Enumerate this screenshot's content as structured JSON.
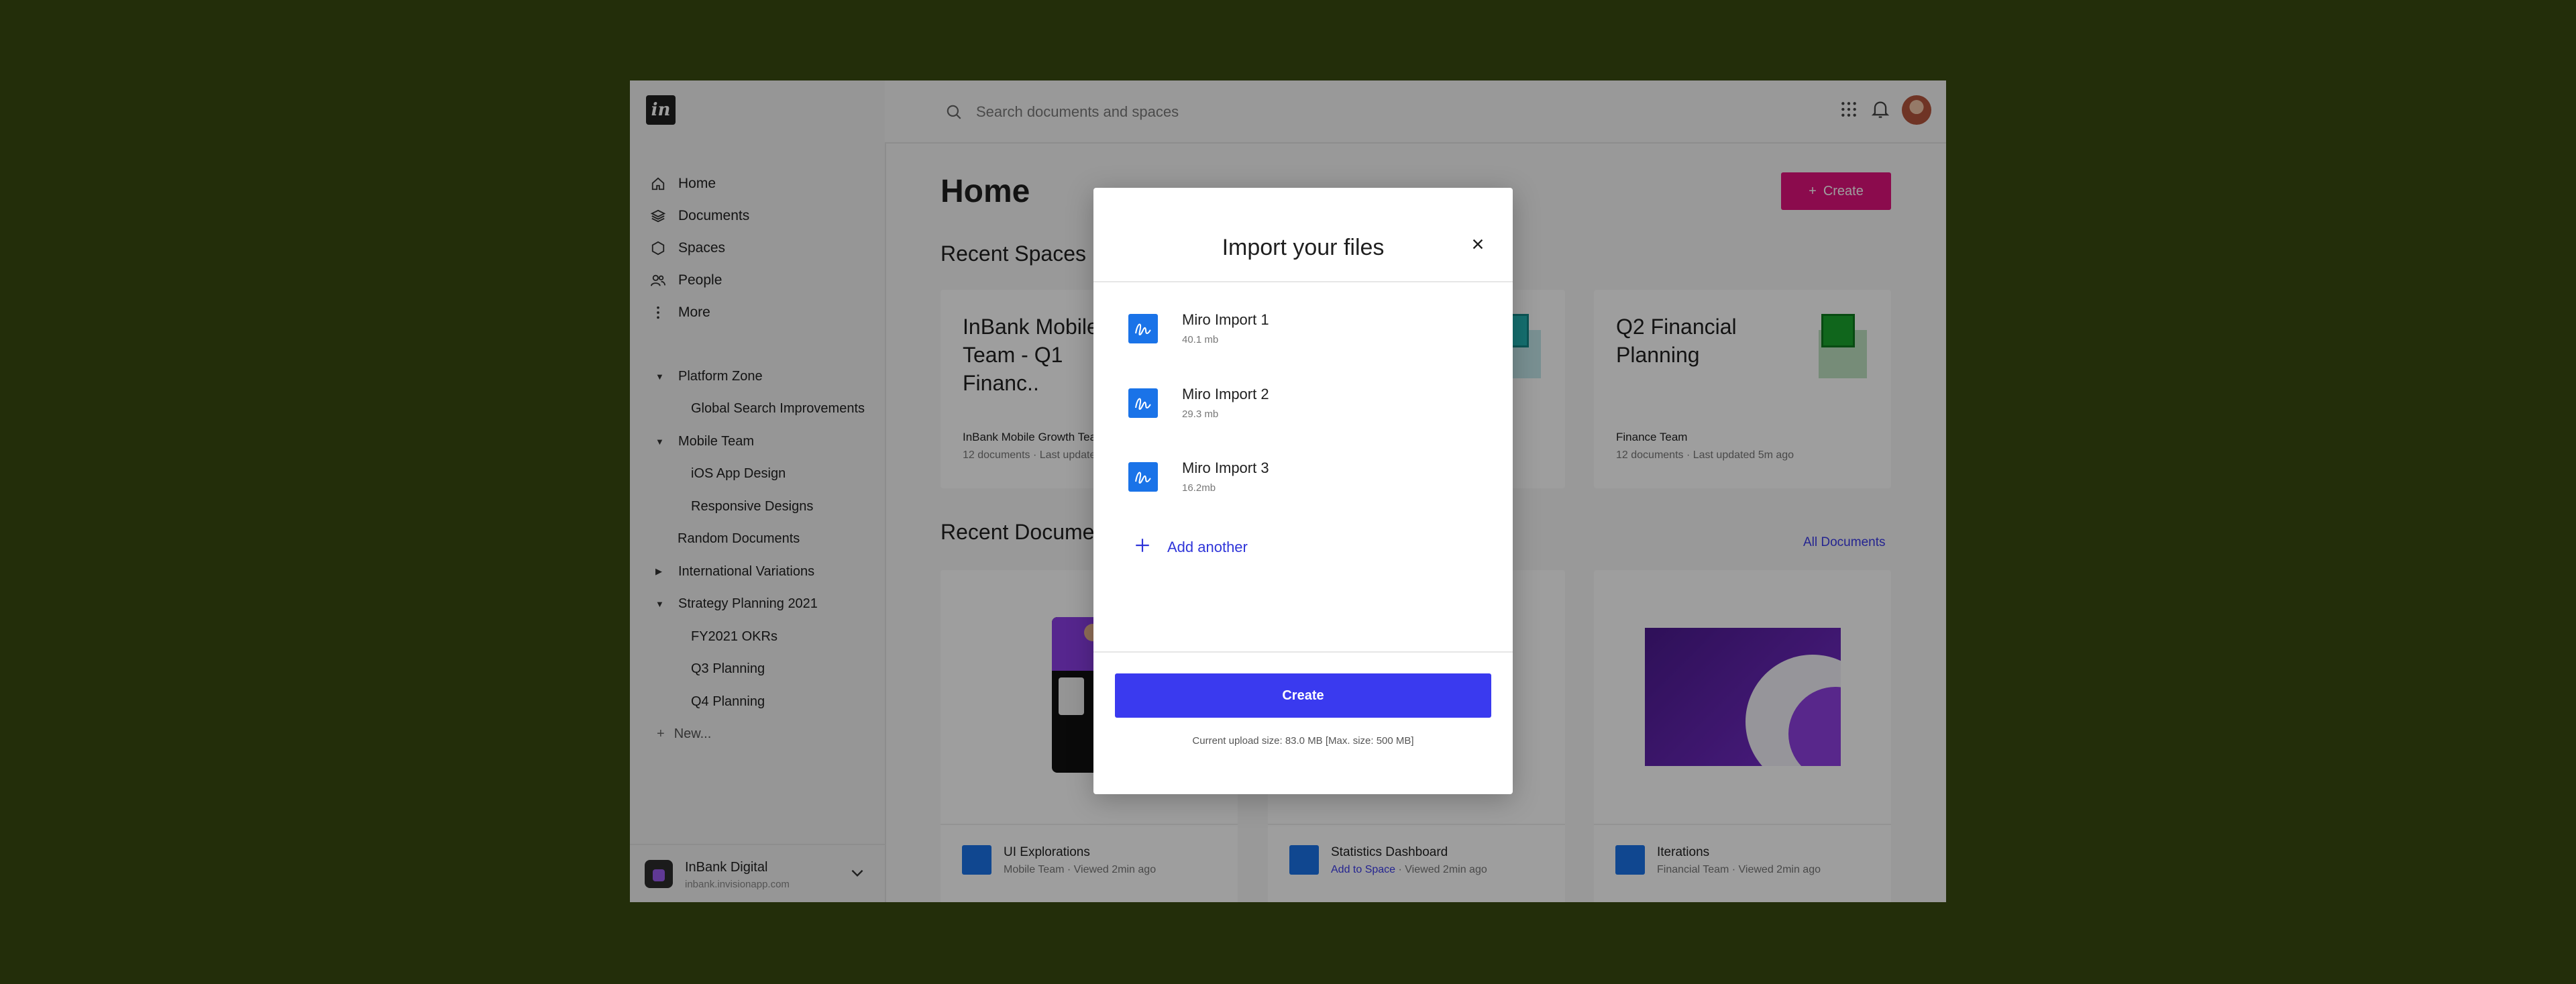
{
  "sidebar": {
    "nav": [
      {
        "label": "Home",
        "icon": "home-icon"
      },
      {
        "label": "Documents",
        "icon": "layers-icon"
      },
      {
        "label": "Spaces",
        "icon": "hexagon-icon"
      },
      {
        "label": "People",
        "icon": "people-icon"
      },
      {
        "label": "More",
        "icon": "more-vertical-icon"
      }
    ],
    "tree": [
      {
        "label": "Platform Zone",
        "level": 0,
        "expanded": true
      },
      {
        "label": "Global Search Improvements",
        "level": 1
      },
      {
        "label": "Mobile Team",
        "level": 0,
        "expanded": true
      },
      {
        "label": "iOS App Design",
        "level": 1
      },
      {
        "label": "Responsive Designs",
        "level": 1
      },
      {
        "label": "Random Documents",
        "level": 0
      },
      {
        "label": "International Variations",
        "level": 0,
        "expanded": false
      },
      {
        "label": "Strategy Planning 2021",
        "level": 0,
        "expanded": true
      },
      {
        "label": "FY2021 OKRs",
        "level": 1
      },
      {
        "label": "Q3 Planning",
        "level": 1
      },
      {
        "label": "Q4 Planning",
        "level": 1
      }
    ],
    "new_label": "New...",
    "workspace": {
      "name": "InBank Digital",
      "url": "inbank.invisionapp.com"
    }
  },
  "topbar": {
    "search_placeholder": "Search documents and spaces"
  },
  "main": {
    "title": "Home",
    "create_label": "Create",
    "recent_spaces_title": "Recent Spaces",
    "recent_documents_title": "Recent Documents",
    "all_documents_label": "All Documents",
    "spaces": [
      {
        "title": "InBank Mobile Team - Q1 Financ..",
        "team": "InBank Mobile Growth Team",
        "documents": "12 documents",
        "updated": "Last updated 5m ago"
      },
      {
        "title": "",
        "team": "",
        "documents": "",
        "updated": ""
      },
      {
        "title": "Q2 Financial Planning",
        "team": "Finance Team",
        "documents": "12 documents",
        "updated": "Last updated 5m ago"
      }
    ],
    "documents": [
      {
        "title": "UI Explorations",
        "team": "Mobile Team",
        "viewed": "Viewed 2min ago"
      },
      {
        "title": "Statistics Dashboard",
        "team": "Add to Space",
        "viewed": "Viewed 2min ago"
      },
      {
        "title": "Iterations",
        "team": "Financial Team",
        "viewed": "Viewed 2min ago"
      }
    ]
  },
  "modal": {
    "title": "Import your files",
    "files": [
      {
        "name": "Miro Import 1",
        "size": "40.1 mb"
      },
      {
        "name": "Miro Import 2",
        "size": "29.3 mb"
      },
      {
        "name": "Miro Import 3",
        "size": "16.2mb"
      }
    ],
    "add_another_label": "Add another",
    "create_label": "Create",
    "upload_note": "Current upload size: 83.0 MB [Max. size: 500 MB]"
  },
  "colors": {
    "background": "#232e0a",
    "accent_pink": "#e0127c",
    "primary_blue": "#3a3aef",
    "link_blue": "#2f35d9",
    "file_icon_blue": "#1a73e8"
  }
}
